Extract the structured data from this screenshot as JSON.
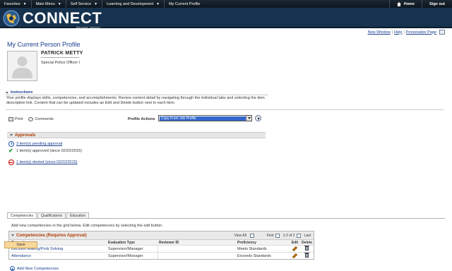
{
  "topnav": {
    "menus": [
      {
        "label": "Favorites"
      },
      {
        "label": "Main Menu"
      },
      {
        "label": "Self Service"
      },
      {
        "label": "Learning and Development"
      }
    ],
    "breadcrumb": "My Current Profile",
    "home_label": "Home",
    "signout_label": "Sign out"
  },
  "banner": {
    "logo_text": "CONNECT",
    "logo_sub": "Maryland Judiciary"
  },
  "pagelinks": {
    "new_window": "New Window",
    "help": "Help",
    "personalize": "Personalize Page"
  },
  "profile": {
    "page_title": "My Current Person Profile",
    "name": "PATRICK METTY",
    "job_title": "Special Police Officer I"
  },
  "instructions": {
    "heading": "Instructions",
    "text": "Your profile displays skills, competencies, and accomplishments. Review content detail by navigating through the individual tabs and selecting the item description link. Content that can be updated includes an Edit and Delete button next to each item."
  },
  "actions": {
    "print": "Print",
    "comments": "Comments",
    "profile_actions_label": "Profile Actions",
    "profile_actions_value": "Copy From Job Profile"
  },
  "approvals": {
    "heading": "Approvals",
    "pending": "3 item(s) pending approval",
    "approved": "1 item(s) approved (since 02/22/2015)",
    "denied": "1 item(s) denied (since 02/22/2015)"
  },
  "tabs": [
    {
      "label": "Competencies"
    },
    {
      "label": "Qualifications"
    },
    {
      "label": "Education"
    }
  ],
  "grid": {
    "instruction": "Add new competencies in the grid below. Edit competencies by selecting the edit button.",
    "title": "Competencies (Requires Approval)",
    "view_all": "View All",
    "first": "First",
    "range": "1-2 of 2",
    "last": "Last",
    "columns": [
      "Competency",
      "Evaluation Type",
      "Reviewer ID",
      "Proficiency",
      "Edit",
      "Delete"
    ],
    "rows": [
      {
        "competency": "Decision Making/Prob Solving",
        "evaluation": "Supervisor/Manager",
        "reviewer": "",
        "proficiency": "Meets Standards"
      },
      {
        "competency": "Attendance",
        "evaluation": "Supervisor/Manager",
        "reviewer": "",
        "proficiency": "Exceeds Standards"
      }
    ],
    "add_label": "Add New Competencies"
  },
  "save_label": "Save",
  "colors": {
    "nav_bg": "#16324f",
    "link": "#1a3f8f",
    "section_title": "#b03a00",
    "save_bg": "#f8d79a"
  }
}
